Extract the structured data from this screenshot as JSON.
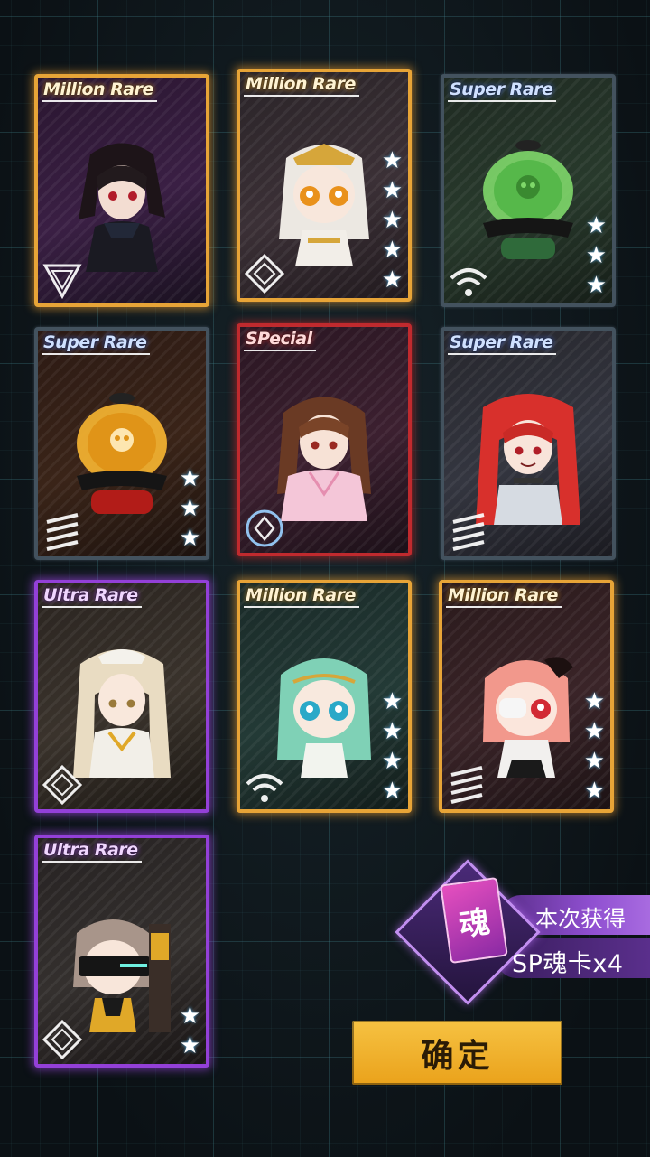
{
  "cards": [
    {
      "rarity": "Million Rare",
      "stars": 0,
      "class_icon": "triangle-class-icon",
      "art_color": "#2a1630"
    },
    {
      "rarity": "Million Rare",
      "stars": 5,
      "class_icon": "diamond-class-icon",
      "art_color": "#2a2428"
    },
    {
      "rarity": "Super Rare",
      "stars": 3,
      "class_icon": "signal-class-icon",
      "art_color": "#1f2a22"
    },
    {
      "rarity": "Super Rare",
      "stars": 3,
      "class_icon": "stripes-class-icon",
      "art_color": "#2c1a14"
    },
    {
      "rarity": "SPecial",
      "stars": 0,
      "class_icon": "circle-diamond-class-icon",
      "art_color": "#2a1622"
    },
    {
      "rarity": "Super Rare",
      "stars": 0,
      "class_icon": "stripes-class-icon",
      "art_color": "#26262c"
    },
    {
      "rarity": "Ultra Rare",
      "stars": 0,
      "class_icon": "diamond-class-icon",
      "art_color": "#2a2420"
    },
    {
      "rarity": "Million Rare",
      "stars": 4,
      "class_icon": "signal-class-icon",
      "art_color": "#1a2a28"
    },
    {
      "rarity": "Million Rare",
      "stars": 4,
      "class_icon": "stripes-class-icon",
      "art_color": "#2a1a1c"
    },
    {
      "rarity": "Ultra Rare",
      "stars": 2,
      "class_icon": "diamond-class-icon",
      "art_color": "#262222"
    }
  ],
  "soul_reward": {
    "icon_char": "魂",
    "label": "本次获得",
    "value": "SP魂卡x4"
  },
  "confirm_label": "确定",
  "colors": {
    "million_rare": "#e7a437",
    "super_rare": "#43525e",
    "special": "#c02a2e",
    "ultra_rare": "#9340d8",
    "confirm": "#f2b231"
  }
}
